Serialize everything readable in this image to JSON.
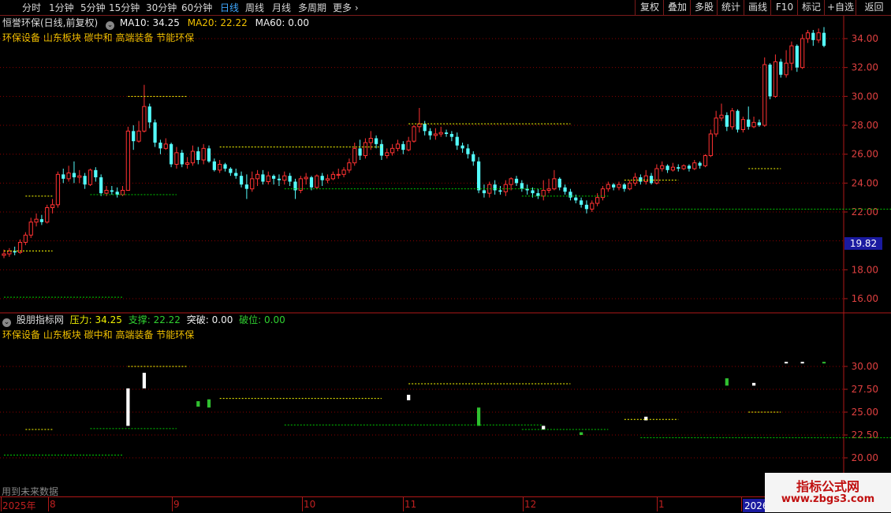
{
  "toolbar": {
    "periods": [
      "分时",
      "1分钟",
      "5分钟",
      "15分钟",
      "30分钟",
      "60分钟",
      "日线",
      "周线",
      "月线",
      "多周期",
      "更多"
    ],
    "active_period": "日线",
    "right_buttons": [
      "复权",
      "叠加",
      "多股",
      "统计",
      "画线",
      "F10",
      "标记",
      "+自选",
      "返回"
    ]
  },
  "main_chart": {
    "title": "恒誉环保(日线,前复权)",
    "ma10": "MA10: 34.25",
    "ma20": "MA20: 22.22",
    "ma60": "MA60: 0.00",
    "sectors": "环保设备 山东板块 碳中和 高端装备 节能环保",
    "price_label": "19.82",
    "y_ticks": [
      "34.00",
      "32.00",
      "30.00",
      "28.00",
      "26.00",
      "24.00",
      "22.00",
      "18.00",
      "16.00"
    ]
  },
  "indicator_chart": {
    "name": "股朋指标网",
    "pressure": "压力: 34.25",
    "support": "支撑: 22.22",
    "breakout": "突破: 0.00",
    "breakdown": "破位: 0.00",
    "sectors": "环保设备 山东板块 碳中和 高端装备 节能环保",
    "y_ticks": [
      "30.00",
      "27.50",
      "25.00",
      "22.50",
      "20.00"
    ],
    "footer_note": "用到未来数据"
  },
  "time_axis": {
    "labels": [
      "2025年",
      "8",
      "9",
      "10",
      "11",
      "12",
      "1",
      "2026年"
    ]
  },
  "watermark": {
    "line1": "指标公式网",
    "line2": "www.zbgs3.com"
  },
  "colors": {
    "up": "#ff3232",
    "down": "#54fcfc",
    "resistance": "#ffff00",
    "support": "#00cc00",
    "grid": "#8b0000"
  },
  "chart_data": {
    "type": "candlestick",
    "x": [
      "2025-07",
      "2025-08",
      "2025-09",
      "2025-10",
      "2025-11",
      "2025-12",
      "2026-01",
      "2026-02"
    ],
    "candles": [
      [
        19.0,
        19.1,
        19.4,
        18.8
      ],
      [
        19.1,
        19.3,
        19.5,
        18.9
      ],
      [
        19.3,
        19.2,
        19.6,
        19.0
      ],
      [
        19.2,
        19.9,
        20.1,
        19.1
      ],
      [
        19.9,
        20.4,
        20.6,
        19.7
      ],
      [
        20.4,
        21.3,
        21.6,
        20.2
      ],
      [
        21.3,
        21.5,
        21.9,
        21.0
      ],
      [
        21.5,
        21.3,
        21.8,
        21.1
      ],
      [
        21.3,
        22.3,
        22.5,
        21.2
      ],
      [
        22.3,
        22.5,
        22.9,
        21.9
      ],
      [
        22.5,
        24.6,
        24.8,
        22.3
      ],
      [
        24.6,
        24.3,
        25.0,
        24.0
      ],
      [
        24.3,
        24.7,
        25.2,
        24.1
      ],
      [
        24.7,
        24.4,
        25.5,
        24.0
      ],
      [
        24.4,
        24.5,
        24.9,
        24.0
      ],
      [
        24.5,
        23.9,
        24.7,
        23.6
      ],
      [
        23.9,
        24.9,
        25.0,
        23.8
      ],
      [
        24.9,
        24.4,
        25.1,
        24.1
      ],
      [
        24.4,
        23.3,
        24.6,
        23.1
      ],
      [
        23.3,
        23.5,
        23.8,
        23.1
      ],
      [
        23.5,
        23.4,
        23.8,
        23.2
      ],
      [
        23.4,
        23.2,
        23.7,
        23.0
      ],
      [
        23.2,
        23.5,
        23.8,
        23.1
      ],
      [
        23.5,
        27.6,
        27.9,
        25.3
      ],
      [
        27.6,
        26.9,
        28.0,
        26.3
      ],
      [
        26.9,
        27.6,
        28.3,
        26.8
      ],
      [
        27.6,
        29.3,
        30.8,
        27.5
      ],
      [
        29.3,
        28.2,
        29.5,
        27.8
      ],
      [
        28.2,
        26.8,
        28.4,
        26.5
      ],
      [
        26.8,
        26.4,
        27.0,
        26.0
      ],
      [
        26.4,
        26.7,
        27.1,
        26.3
      ],
      [
        26.7,
        25.3,
        26.8,
        25.1
      ],
      [
        25.3,
        26.1,
        26.5,
        25.0
      ],
      [
        26.1,
        25.3,
        26.3,
        25.1
      ],
      [
        25.3,
        25.4,
        25.8,
        25.0
      ],
      [
        25.4,
        26.2,
        26.6,
        25.2
      ],
      [
        26.2,
        25.6,
        26.5,
        25.3
      ],
      [
        25.6,
        26.4,
        26.7,
        25.3
      ],
      [
        26.4,
        25.5,
        26.6,
        25.4
      ],
      [
        25.5,
        24.9,
        25.7,
        24.8
      ],
      [
        24.9,
        25.3,
        25.6,
        24.7
      ],
      [
        25.3,
        25.0,
        25.4,
        24.8
      ],
      [
        25.0,
        24.7,
        25.1,
        24.5
      ],
      [
        24.7,
        24.5,
        25.0,
        24.3
      ],
      [
        24.5,
        23.9,
        24.8,
        23.7
      ],
      [
        23.9,
        23.6,
        24.6,
        22.9
      ],
      [
        23.6,
        24.3,
        24.8,
        23.4
      ],
      [
        24.3,
        24.6,
        24.9,
        23.8
      ],
      [
        24.6,
        24.1,
        24.9,
        23.9
      ],
      [
        24.1,
        24.5,
        24.8,
        23.9
      ],
      [
        24.5,
        24.3,
        24.6,
        23.9
      ],
      [
        24.3,
        24.2,
        24.6,
        23.8
      ],
      [
        24.2,
        24.5,
        24.8,
        23.9
      ],
      [
        24.5,
        24.1,
        24.7,
        23.8
      ],
      [
        24.1,
        23.5,
        24.3,
        22.9
      ],
      [
        23.5,
        24.3,
        24.5,
        23.3
      ],
      [
        24.3,
        24.4,
        24.7,
        23.9
      ],
      [
        24.4,
        23.7,
        24.5,
        23.5
      ],
      [
        23.7,
        24.5,
        24.6,
        23.6
      ],
      [
        24.5,
        24.2,
        24.7,
        23.8
      ],
      [
        24.2,
        24.3,
        24.6,
        24.0
      ],
      [
        24.3,
        24.6,
        24.8,
        24.2
      ],
      [
        24.6,
        24.6,
        25.0,
        24.3
      ],
      [
        24.6,
        24.9,
        25.1,
        24.4
      ],
      [
        24.9,
        25.4,
        25.7,
        24.7
      ],
      [
        25.4,
        26.4,
        26.8,
        25.2
      ],
      [
        26.4,
        25.9,
        27.0,
        25.6
      ],
      [
        25.9,
        26.8,
        27.1,
        25.7
      ],
      [
        26.8,
        27.1,
        27.6,
        26.3
      ],
      [
        27.1,
        26.7,
        27.3,
        26.4
      ],
      [
        26.7,
        25.9,
        27.0,
        25.6
      ],
      [
        25.9,
        26.1,
        26.4,
        25.7
      ],
      [
        26.1,
        26.4,
        26.7,
        25.9
      ],
      [
        26.4,
        26.7,
        27.0,
        26.2
      ],
      [
        26.7,
        26.3,
        26.9,
        26.0
      ],
      [
        26.3,
        26.9,
        27.2,
        26.2
      ],
      [
        26.9,
        27.9,
        28.0,
        26.8
      ],
      [
        27.9,
        28.1,
        29.2,
        27.5
      ],
      [
        28.1,
        27.6,
        28.3,
        27.3
      ],
      [
        27.6,
        27.3,
        27.8,
        27.0
      ],
      [
        27.3,
        27.4,
        27.8,
        27.0
      ],
      [
        27.4,
        27.5,
        27.9,
        27.2
      ],
      [
        27.5,
        27.4,
        27.7,
        27.2
      ],
      [
        27.4,
        27.2,
        27.6,
        26.9
      ],
      [
        27.2,
        26.6,
        27.5,
        26.3
      ],
      [
        26.6,
        26.4,
        26.8,
        26.1
      ],
      [
        26.4,
        26.0,
        26.7,
        25.7
      ],
      [
        26.0,
        25.5,
        26.2,
        25.2
      ],
      [
        25.5,
        23.5,
        25.8,
        23.3
      ],
      [
        23.5,
        23.3,
        23.9,
        23.0
      ],
      [
        23.3,
        23.9,
        24.1,
        23.0
      ],
      [
        23.9,
        23.5,
        24.2,
        23.2
      ],
      [
        23.5,
        23.4,
        23.8,
        23.2
      ],
      [
        23.4,
        23.9,
        24.2,
        23.1
      ],
      [
        23.9,
        24.3,
        24.4,
        23.5
      ],
      [
        24.3,
        24.0,
        24.5,
        23.8
      ],
      [
        24.0,
        23.6,
        24.2,
        23.4
      ],
      [
        23.6,
        23.5,
        23.9,
        23.2
      ],
      [
        23.5,
        23.3,
        23.7,
        23.0
      ],
      [
        23.3,
        23.1,
        23.6,
        22.9
      ],
      [
        23.1,
        23.5,
        24.2,
        22.8
      ],
      [
        23.5,
        23.6,
        24.3,
        23.3
      ],
      [
        23.6,
        24.3,
        24.9,
        23.5
      ],
      [
        24.3,
        23.7,
        24.4,
        23.5
      ],
      [
        23.7,
        23.4,
        23.9,
        23.2
      ],
      [
        23.4,
        23.0,
        23.6,
        22.8
      ],
      [
        23.0,
        22.8,
        23.2,
        22.6
      ],
      [
        22.8,
        22.5,
        23.0,
        22.3
      ],
      [
        22.5,
        22.2,
        22.8,
        21.9
      ],
      [
        22.2,
        22.6,
        22.8,
        22.0
      ],
      [
        22.6,
        23.0,
        23.3,
        22.4
      ],
      [
        23.0,
        23.6,
        23.8,
        22.8
      ],
      [
        23.6,
        23.9,
        24.1,
        23.4
      ],
      [
        23.9,
        23.7,
        24.0,
        23.5
      ],
      [
        23.7,
        23.9,
        24.1,
        23.5
      ],
      [
        23.9,
        23.6,
        24.0,
        23.4
      ],
      [
        23.6,
        24.0,
        24.2,
        23.5
      ],
      [
        24.0,
        24.4,
        24.7,
        23.8
      ],
      [
        24.4,
        24.1,
        24.6,
        23.9
      ],
      [
        24.1,
        24.5,
        24.9,
        23.9
      ],
      [
        24.5,
        24.0,
        24.7,
        23.9
      ],
      [
        24.0,
        25.0,
        25.3,
        23.9
      ],
      [
        25.0,
        25.2,
        25.5,
        24.8
      ],
      [
        25.2,
        24.9,
        25.3,
        24.7
      ],
      [
        24.9,
        25.1,
        25.4,
        24.8
      ],
      [
        25.1,
        25.0,
        25.3,
        24.8
      ],
      [
        25.0,
        25.2,
        25.3,
        24.9
      ],
      [
        25.2,
        25.0,
        25.3,
        24.8
      ],
      [
        25.0,
        25.4,
        25.6,
        24.9
      ],
      [
        25.4,
        25.2,
        25.5,
        25.0
      ],
      [
        25.2,
        25.9,
        26.0,
        25.1
      ],
      [
        25.9,
        27.4,
        27.7,
        25.8
      ],
      [
        27.4,
        28.5,
        29.0,
        27.2
      ],
      [
        28.5,
        28.7,
        29.5,
        28.3
      ],
      [
        28.7,
        27.9,
        28.9,
        27.6
      ],
      [
        27.9,
        29.0,
        29.2,
        27.7
      ],
      [
        29.0,
        27.7,
        29.1,
        27.5
      ],
      [
        27.7,
        28.4,
        28.6,
        27.5
      ],
      [
        28.4,
        27.9,
        29.3,
        27.7
      ],
      [
        27.9,
        28.2,
        28.6,
        27.8
      ],
      [
        28.2,
        28.0,
        28.4,
        27.9
      ],
      [
        28.0,
        32.2,
        32.7,
        27.9
      ],
      [
        32.2,
        30.0,
        32.3,
        29.8
      ],
      [
        30.0,
        32.4,
        32.9,
        29.9
      ],
      [
        32.4,
        31.5,
        32.6,
        31.3
      ],
      [
        31.5,
        32.3,
        33.2,
        31.3
      ],
      [
        32.3,
        33.5,
        33.8,
        31.8
      ],
      [
        33.5,
        32.0,
        33.6,
        31.7
      ],
      [
        32.0,
        34.0,
        34.3,
        31.9
      ],
      [
        34.0,
        34.4,
        34.6,
        33.7
      ],
      [
        34.4,
        33.9,
        34.6,
        33.5
      ],
      [
        33.9,
        34.4,
        34.7,
        33.7
      ],
      [
        34.4,
        33.5,
        34.8,
        33.4
      ]
    ],
    "ylim": [
      15,
      36
    ],
    "resistance_levels": [
      {
        "from": 0,
        "to": 9,
        "value": 19.3
      },
      {
        "from": 4,
        "to": 9,
        "value": 23.1
      },
      {
        "from": 23,
        "to": 34,
        "value": 30.0
      },
      {
        "from": 40,
        "to": 70,
        "value": 26.5
      },
      {
        "from": 75,
        "to": 105,
        "value": 28.1
      },
      {
        "from": 115,
        "to": 125,
        "value": 24.2
      },
      {
        "from": 138,
        "to": 144,
        "value": 25.0
      }
    ],
    "support_levels": [
      {
        "from": 0,
        "to": 22,
        "value": 16.1
      },
      {
        "from": 16,
        "to": 32,
        "value": 23.2
      },
      {
        "from": 52,
        "to": 100,
        "value": 23.6
      },
      {
        "from": 96,
        "to": 112,
        "value": 23.1
      },
      {
        "from": 118,
        "to": 175,
        "value": 22.2
      }
    ]
  }
}
